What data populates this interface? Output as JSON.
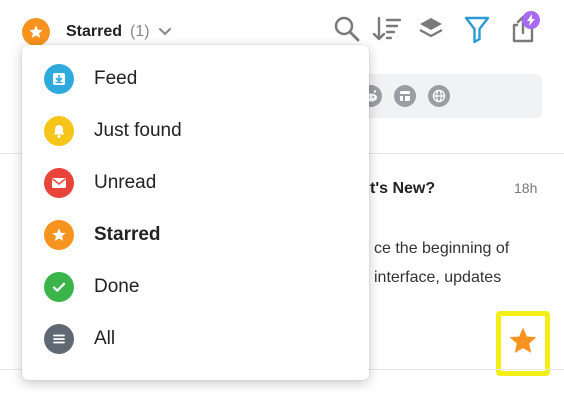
{
  "header": {
    "title": "Starred",
    "count": "(1)",
    "title_icon": "star-icon",
    "accent_color": "#f7931e",
    "toolbar": [
      "search-icon",
      "sort-icon",
      "layers-icon",
      "filter-icon",
      "share-icon"
    ]
  },
  "menu": {
    "items": [
      {
        "label": "Feed",
        "icon": "feed-icon",
        "color": "#2eaadc",
        "active": false
      },
      {
        "label": "Just found",
        "icon": "bell-icon",
        "color": "#f5c518",
        "active": false
      },
      {
        "label": "Unread",
        "icon": "mail-icon",
        "color": "#e8443a",
        "active": false
      },
      {
        "label": "Starred",
        "icon": "star-icon",
        "color": "#f7931e",
        "active": true
      },
      {
        "label": "Done",
        "icon": "check-icon",
        "color": "#3bb54a",
        "active": false
      },
      {
        "label": "All",
        "icon": "list-icon",
        "color": "#5f6873",
        "active": false
      }
    ]
  },
  "article": {
    "title_fragment": "t's New?",
    "time": "18h",
    "lines": [
      "ce the beginning of",
      "interface, updates"
    ],
    "star_color": "#f7931e",
    "highlight_color": "#f3ee16"
  },
  "sources": [
    "reddit-icon",
    "app-icon",
    "globe-icon"
  ]
}
